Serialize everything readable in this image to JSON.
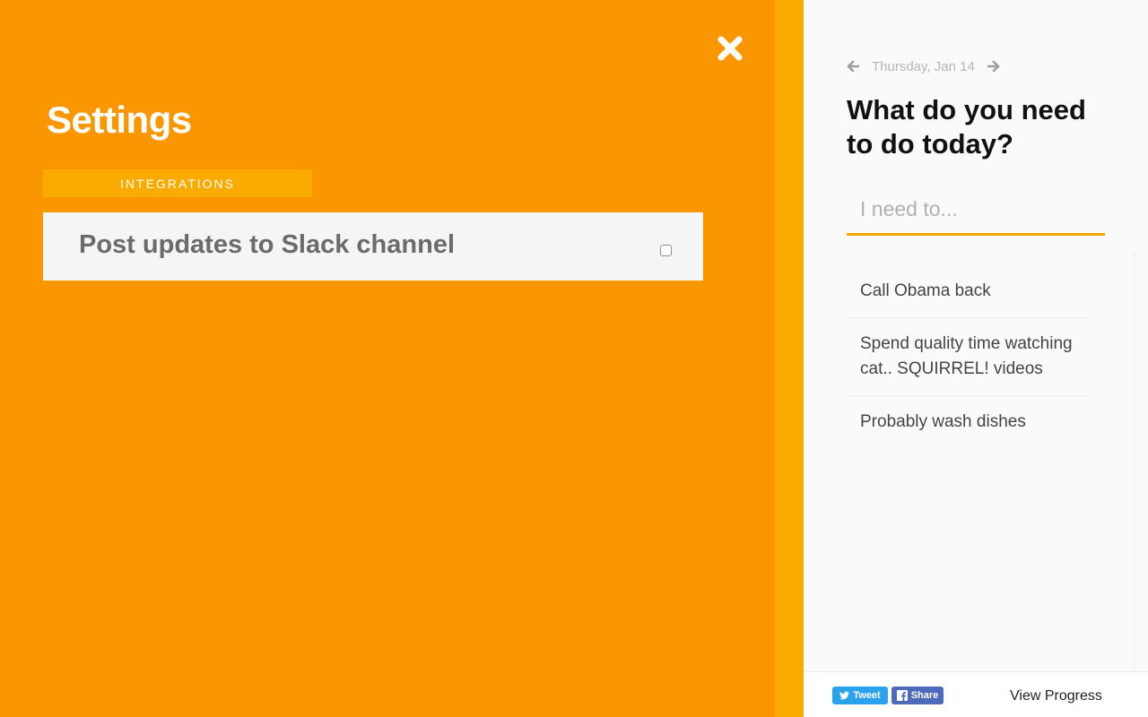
{
  "settings": {
    "title": "Settings",
    "tabs": [
      {
        "label": "INTEGRATIONS"
      }
    ],
    "integrations": [
      {
        "label": "Post updates to Slack channel",
        "checked": false
      }
    ],
    "colors": {
      "panel": "#fa9600",
      "accent": "#fbaa00"
    }
  },
  "todo": {
    "date": "Thursday, Jan 14",
    "heading": "What do you need to do today?",
    "input_placeholder": "I need to...",
    "items": [
      {
        "text": "Call Obama back"
      },
      {
        "text": "Spend quality time watching cat.. SQUIRREL! videos"
      },
      {
        "text": "Probably wash dishes"
      }
    ]
  },
  "footer": {
    "tweet_label": "Tweet",
    "share_label": "Share",
    "view_progress_label": "View Progress"
  },
  "icons": {
    "close": "close-icon",
    "prev": "arrow-left-icon",
    "next": "arrow-right-icon",
    "twitter": "twitter-bird-icon",
    "facebook": "facebook-f-icon"
  }
}
